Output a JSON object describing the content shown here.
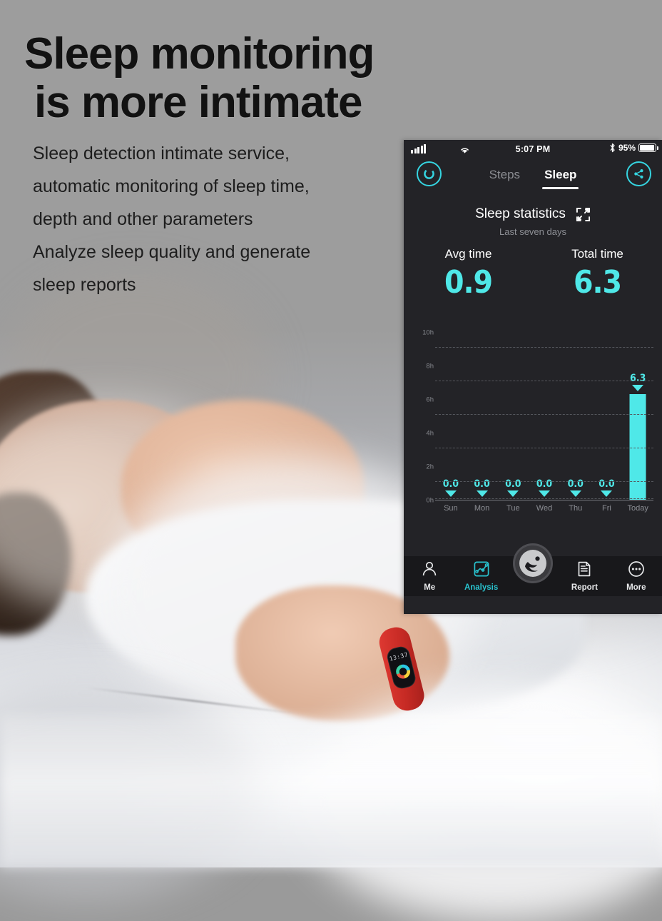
{
  "promo": {
    "headline_line1": "Sleep monitoring",
    "headline_line2": "is more intimate",
    "body": "Sleep detection intimate service,\nautomatic monitoring of sleep time,\ndepth and other parameters\nAnalyze sleep quality and generate\nsleep reports"
  },
  "phone": {
    "statusbar": {
      "time": "5:07 PM",
      "battery_percent": "95%",
      "signal_icon": "cellular-signal-icon",
      "wifi_icon": "wifi-icon",
      "bluetooth_icon": "bluetooth-icon",
      "battery_icon": "battery-icon"
    },
    "appbar": {
      "left_icon": "refresh-ring-icon",
      "right_icon": "share-icon",
      "tabs": [
        {
          "label": "Steps",
          "active": false
        },
        {
          "label": "Sleep",
          "active": true
        }
      ]
    },
    "stats": {
      "title": "Sleep statistics",
      "expand_icon": "expand-fullscreen-icon",
      "subtitle": "Last seven days",
      "metrics": [
        {
          "label": "Avg time",
          "value": "0.9"
        },
        {
          "label": "Total time",
          "value": "6.3"
        }
      ]
    },
    "tabbar": {
      "items": [
        {
          "label": "Me",
          "icon": "person-icon",
          "active": false
        },
        {
          "label": "Analysis",
          "icon": "chart-analysis-icon",
          "active": true
        },
        {
          "label": "Report",
          "icon": "document-report-icon",
          "active": false
        },
        {
          "label": "More",
          "icon": "ellipsis-more-icon",
          "active": false
        }
      ],
      "fab_icon": "running-person-logo-icon"
    },
    "band": {
      "time_display": "13:37"
    }
  },
  "colors": {
    "accent_cyan": "#4fe8e8",
    "tab_active_cyan": "#29c3cf",
    "panel_bg": "#232327",
    "tabbar_bg": "#18181b",
    "grid": "#55575d",
    "muted_text": "#8d8f95"
  },
  "chart_data": {
    "type": "bar",
    "title": "Sleep statistics",
    "subtitle": "Last seven days",
    "categories": [
      "Sun",
      "Mon",
      "Tue",
      "Wed",
      "Thu",
      "Fri",
      "Today"
    ],
    "values": [
      0.0,
      0.0,
      0.0,
      0.0,
      0.0,
      0.0,
      6.3
    ],
    "labels": [
      "0.0",
      "0.0",
      "0.0",
      "0.0",
      "0.0",
      "0.0",
      "6.3"
    ],
    "xlabel": "",
    "ylabel": "",
    "ylim": [
      0,
      11
    ],
    "yticks": [
      0,
      2,
      4,
      6,
      8,
      10
    ],
    "ytick_labels": [
      "0h",
      "2h",
      "4h",
      "6h",
      "8h",
      "10h"
    ],
    "grid": true,
    "grid_style": "dashed",
    "legend": false,
    "bar_color": "#4fe8e8"
  }
}
